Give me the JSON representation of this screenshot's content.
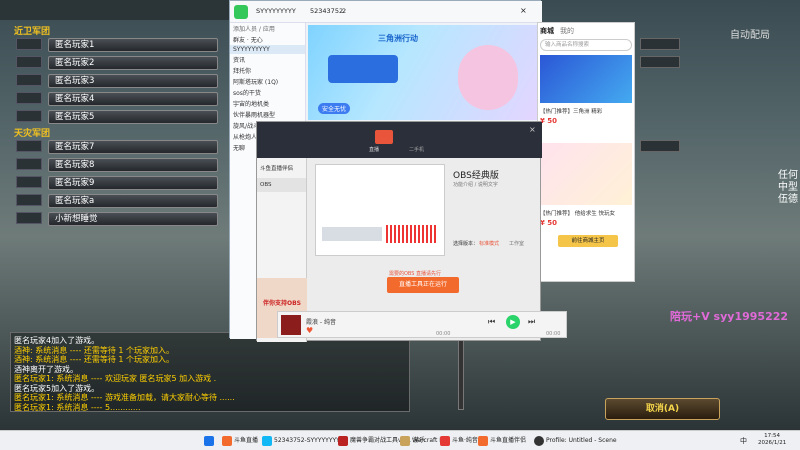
{
  "game": {
    "team1_title": "近卫军团",
    "team2_title": "天灾军团",
    "team1_slots": [
      "匿名玩家1",
      "匿名玩家2",
      "匿名玩家3",
      "匿名玩家4",
      "匿名玩家5"
    ],
    "team2_slots": [
      "匿名玩家7",
      "匿名玩家8",
      "匿名玩家9",
      "匿名玩家a",
      "小新想睡觉"
    ],
    "top_right_text": "自动配局",
    "side_text": [
      "任何",
      "中型",
      "伍德"
    ],
    "chat_lines": [
      {
        "text": "匿名玩家4加入了游戏。",
        "style": "b"
      },
      {
        "text": "酒神: 系统消息 ---- 还需等待 1 个玩家加入。",
        "style": "y"
      },
      {
        "text": "酒神: 系统消息 ---- 还需等待 1 个玩家加入。",
        "style": "y"
      },
      {
        "text": "酒神离开了游戏。",
        "style": "b"
      },
      {
        "text": "匿名玩家1: 系统消息 ---- 欢迎玩家 匿名玩家5 加入游戏 .",
        "style": "y"
      },
      {
        "text": "匿名玩家5加入了游戏。",
        "style": "b"
      },
      {
        "text": "匿名玩家1: 系统消息 ---- 游戏准备加载，请大家耐心等待 ......",
        "style": "y"
      },
      {
        "text": "匿名玩家1: 系统消息 ---- 5............",
        "style": "y"
      }
    ],
    "cancel_button": "取消(A)",
    "watermark": "陪玩+V syy1995222"
  },
  "qq": {
    "title": "SYYYYYYYYY",
    "group_id": "52343752",
    "member_count": "2",
    "tab": "在线",
    "list_header": "添加人员 / 应用",
    "list_items": [
      "群友 · 无心",
      "SYYYYYYYYY",
      "资讯",
      "拜托你",
      "阿斯塔玩家 (1Q)",
      "sos的干货",
      "宇宙的地机类",
      "伙伴暴雨机器型",
      "旋风/战斗机器",
      "从枪炮人员",
      "无聊"
    ],
    "banner_text": "三角洲行动",
    "banner_sub": "安全无忧"
  },
  "obs": {
    "tabs": [
      "直播",
      "二手机"
    ],
    "sidebar": [
      "斗鱼直播伴侣",
      "OBS"
    ],
    "title": "OBS经典版",
    "desc": "功能介绍 / 说明文字",
    "option_label": "选择版本：",
    "option1": "标准模式",
    "option2": "工作室",
    "run_button": "直播工具正在运行",
    "notice": "需要的OBS 直播请先行",
    "promo": "伴你支持OBS"
  },
  "store": {
    "tab1": "商城",
    "tab2": "我的",
    "search_placeholder": "输入商品名称搜索",
    "item1": "【热门推荐】三角洲 精彩",
    "item2": "【热门推荐】 他给求生 快玩女",
    "price1": "¥ 50",
    "price2": "¥ 50",
    "footer": "前往商城主页"
  },
  "player": {
    "song": "霞浪 - 纯音",
    "time_left": "00:00",
    "time_right": "00:00"
  },
  "taskbar": {
    "items": [
      "斗鱼直播",
      "52343752-SYYYYYYYYY",
      "魔兽争霸对战工具v1.1 游乐",
      "Warcraft III",
      "斗鱼·纯音",
      "斗鱼直播伴侣",
      "Profile: Untitled - Scene"
    ],
    "lang": "中",
    "time": "17:54",
    "date": "2026/1/21"
  }
}
